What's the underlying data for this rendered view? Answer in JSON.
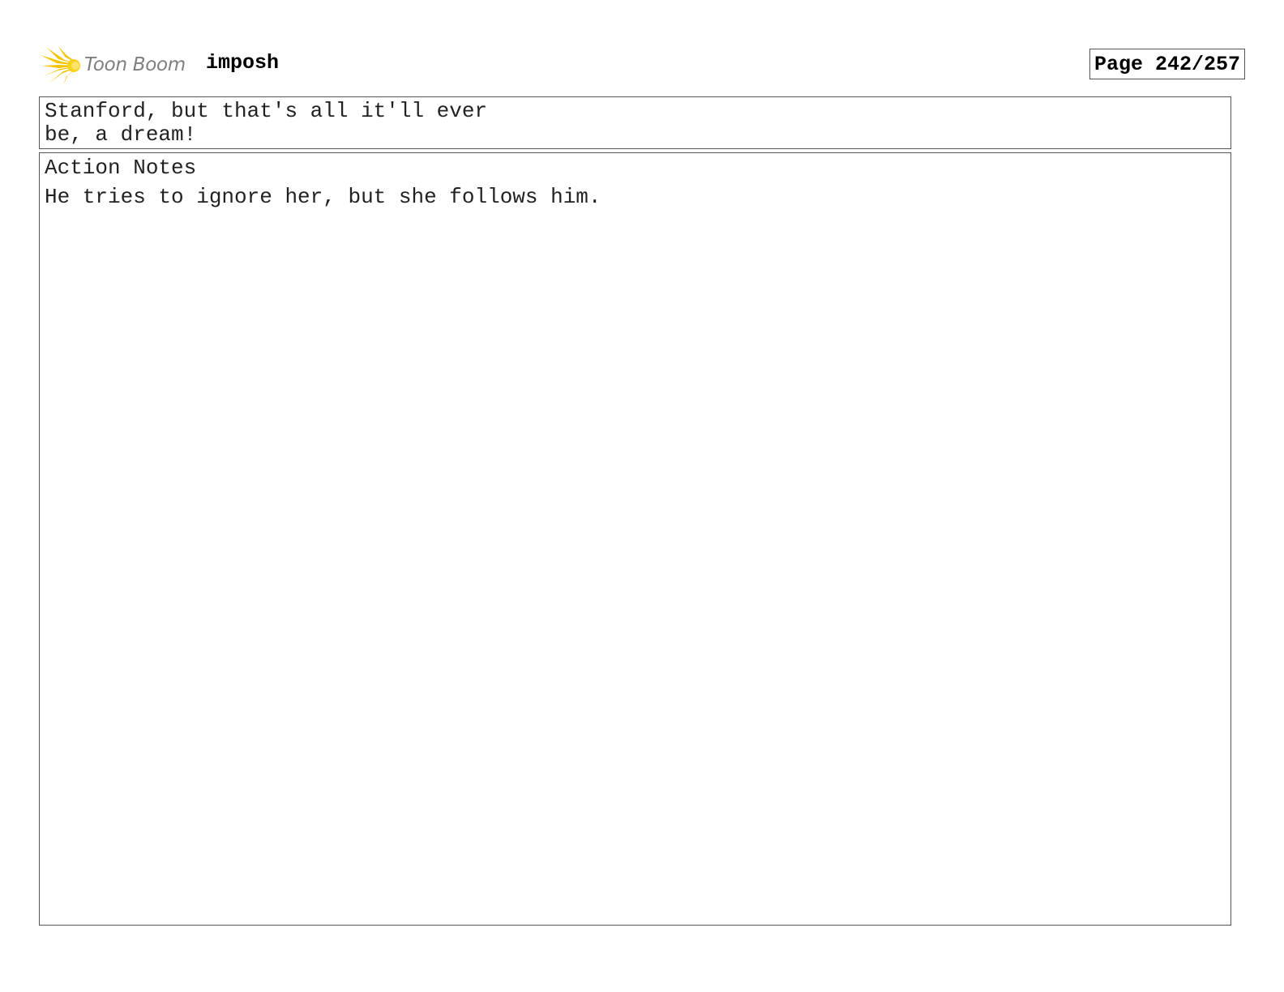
{
  "header": {
    "logo": {
      "icon": "starburst-icon",
      "text": "Toon Boom",
      "colors": {
        "burst": "#f5c400",
        "text": "#7f7f7f"
      }
    },
    "project_title": "imposh",
    "page_counter": "Page 242/257"
  },
  "dialogue": {
    "lines": [
      "Stanford, but that's all it'll ever",
      "be, a dream!"
    ]
  },
  "action_notes": {
    "label": "Action Notes",
    "text": "He tries to ignore her, but she follows him."
  }
}
